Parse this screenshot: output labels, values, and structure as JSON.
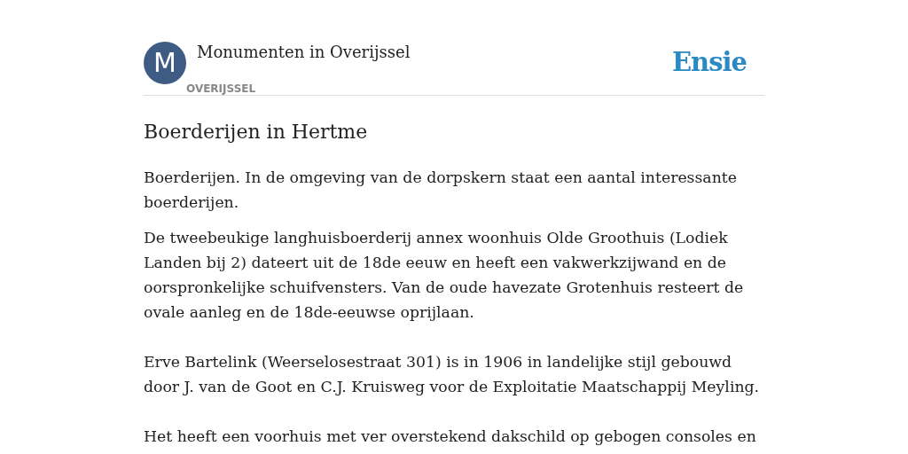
{
  "header": {
    "avatar_letter": "M",
    "title": "Monumenten in Overijssel",
    "category": "OVERIJSSEL",
    "logo": "Ensie"
  },
  "article": {
    "title": "Boerderijen in Hertme",
    "paragraphs": [
      "Boerderijen. In de omgeving van de dorpskern staat een aantal interessante boerderijen.",
      "De tweebeukige langhuisboerderij annex woonhuis Olde Groothuis (Lodiek Landen bij 2) dateert uit de 18de eeuw en heeft een vakwerkzijwand en de oorspronkelijke schuifvensters. Van de oude havezate Grotenhuis resteert de ovale aanleg en de 18de-eeuwse oprijlaan.",
      "Erve Bartelink (Weerselosestraat 301) is in 1906 in landelijke stijl gebouwd door J. van de Goot en C.J. Kruisweg voor de Exploitatie Maatschappij Meyling.",
      "Het heeft een voorhuis met ver overstekend dakschild op gebogen consoles en"
    ]
  }
}
